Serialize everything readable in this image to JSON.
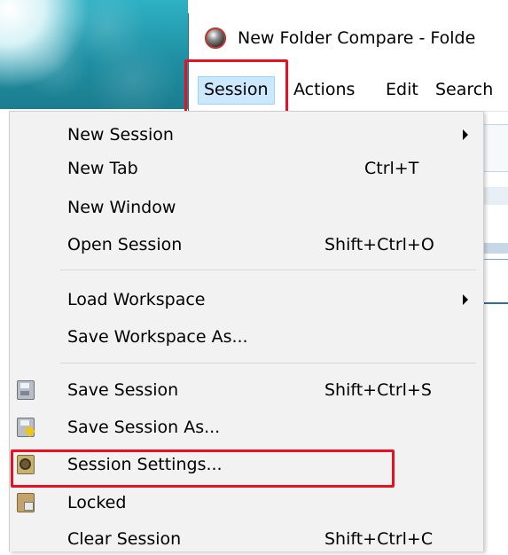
{
  "window": {
    "title": "New Folder Compare - Folde"
  },
  "menubar": {
    "items": [
      {
        "label": "Session",
        "active": true
      },
      {
        "label": "Actions"
      },
      {
        "label": "Edit"
      },
      {
        "label": "Search"
      }
    ]
  },
  "session_menu": {
    "items": [
      {
        "label": "New Session",
        "shortcut": "",
        "submenu": true,
        "icon": ""
      },
      {
        "label": "New Tab",
        "shortcut": "Ctrl+T",
        "submenu": false,
        "icon": ""
      },
      {
        "label": "New Window",
        "shortcut": "",
        "submenu": false,
        "icon": ""
      },
      {
        "label": "Open Session",
        "shortcut": "Shift+Ctrl+O",
        "submenu": false,
        "icon": ""
      },
      {
        "label": "Load Workspace",
        "shortcut": "",
        "submenu": true,
        "icon": ""
      },
      {
        "label": "Save Workspace As...",
        "shortcut": "",
        "submenu": false,
        "icon": ""
      },
      {
        "label": "Save Session",
        "shortcut": "Shift+Ctrl+S",
        "submenu": false,
        "icon": "save-session-icon"
      },
      {
        "label": "Save Session As...",
        "shortcut": "",
        "submenu": false,
        "icon": "save-session-as-icon"
      },
      {
        "label": "Session Settings...",
        "shortcut": "",
        "submenu": false,
        "icon": "session-settings-icon"
      },
      {
        "label": "Locked",
        "shortcut": "",
        "submenu": false,
        "icon": "locked-icon"
      },
      {
        "label": "Clear Session",
        "shortcut": "Shift+Ctrl+C",
        "submenu": false,
        "icon": ""
      }
    ]
  },
  "colors": {
    "highlight_border": "#e81123",
    "menu_active_bg": "#cce8ff",
    "menu_bg": "#f2f2f2"
  }
}
